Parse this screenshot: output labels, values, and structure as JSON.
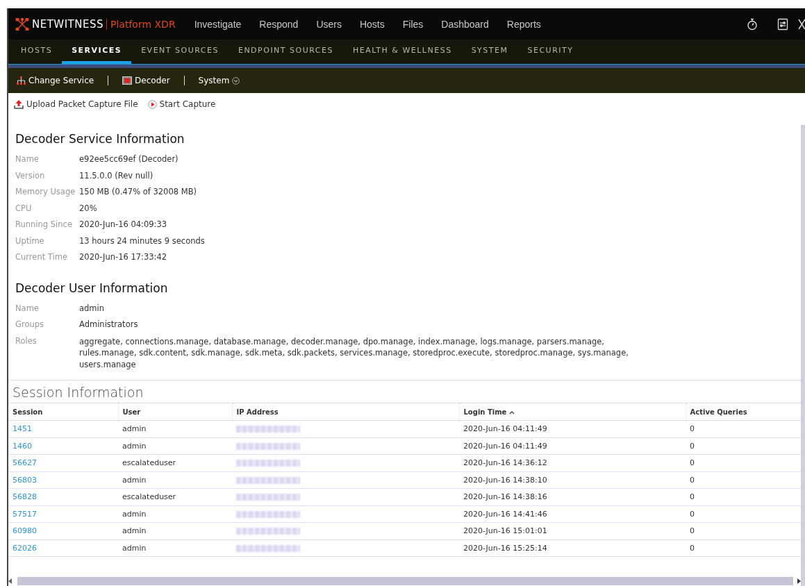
{
  "top_nav": {
    "brand": "NETWITNESS",
    "product": "Platform XDR",
    "items": [
      {
        "label": "Investigate",
        "selected": false
      },
      {
        "label": "Respond",
        "selected": false
      },
      {
        "label": "Users",
        "selected": false
      },
      {
        "label": "Hosts",
        "selected": false
      },
      {
        "label": "Files",
        "selected": false
      },
      {
        "label": "Dashboard",
        "selected": false
      },
      {
        "label": "Reports",
        "selected": false
      }
    ]
  },
  "admin_tabs": [
    {
      "label": "HOSTS",
      "selected": false
    },
    {
      "label": "SERVICES",
      "selected": true
    },
    {
      "label": "EVENT SOURCES",
      "selected": false
    },
    {
      "label": "ENDPOINT SOURCES",
      "selected": false
    },
    {
      "label": "HEALTH & WELLNESS",
      "selected": false
    },
    {
      "label": "SYSTEM",
      "selected": false
    },
    {
      "label": "SECURITY",
      "selected": false
    }
  ],
  "toolbar": {
    "change_service": "Change Service",
    "service": "Decoder",
    "view": "System"
  },
  "actions": [
    "Upload Packet Capture File",
    "Start Capture"
  ],
  "service_info": {
    "title": "Decoder Service Information",
    "fields": [
      {
        "label": "Name",
        "value": "e92ee5cc69ef (Decoder)"
      },
      {
        "label": "Version",
        "value": "11.5.0.0 (Rev null)"
      },
      {
        "label": "Memory Usage",
        "value": "150 MB (0.47% of 32008 MB)"
      },
      {
        "label": "CPU",
        "value": "20%"
      },
      {
        "label": "Running Since",
        "value": "2020-Jun-16 04:09:33"
      },
      {
        "label": "Uptime",
        "value": "13 hours 24 minutes 9 seconds"
      },
      {
        "label": "Current Time",
        "value": "2020-Jun-16 17:33:42"
      }
    ]
  },
  "user_info": {
    "title": "Decoder User Information",
    "fields": [
      {
        "label": "Name",
        "value": "admin"
      },
      {
        "label": "Groups",
        "value": "Administrators"
      },
      {
        "label": "Roles",
        "value": "aggregate, connections.manage, database.manage, decoder.manage, dpo.manage, index.manage, logs.manage, parsers.manage, rules.manage, sdk.content, sdk.manage, sdk.meta, sdk.packets, services.manage, storedproc.execute, storedproc.manage, sys.manage, users.manage"
      }
    ]
  },
  "sessions": {
    "title": "Session Information",
    "columns": [
      "Session",
      "User",
      "IP Address",
      "Login Time",
      "Active Queries"
    ],
    "rows": [
      {
        "session": "1451",
        "user": "admin",
        "login_time": "2020-Jun-16 04:11:49",
        "active_queries": "0"
      },
      {
        "session": "1460",
        "user": "admin",
        "login_time": "2020-Jun-16 04:11:49",
        "active_queries": "0"
      },
      {
        "session": "56627",
        "user": "escalateduser",
        "login_time": "2020-Jun-16 14:36:12",
        "active_queries": "0"
      },
      {
        "session": "56803",
        "user": "admin",
        "login_time": "2020-Jun-16 14:38:10",
        "active_queries": "0"
      },
      {
        "session": "56828",
        "user": "escalateduser",
        "login_time": "2020-Jun-16 14:38:16",
        "active_queries": "0"
      },
      {
        "session": "57517",
        "user": "admin",
        "login_time": "2020-Jun-16 14:41:46",
        "active_queries": "0"
      },
      {
        "session": "60980",
        "user": "admin",
        "login_time": "2020-Jun-16 15:01:01",
        "active_queries": "0"
      },
      {
        "session": "62026",
        "user": "admin",
        "login_time": "2020-Jun-16 15:25:14",
        "active_queries": "0"
      }
    ]
  }
}
